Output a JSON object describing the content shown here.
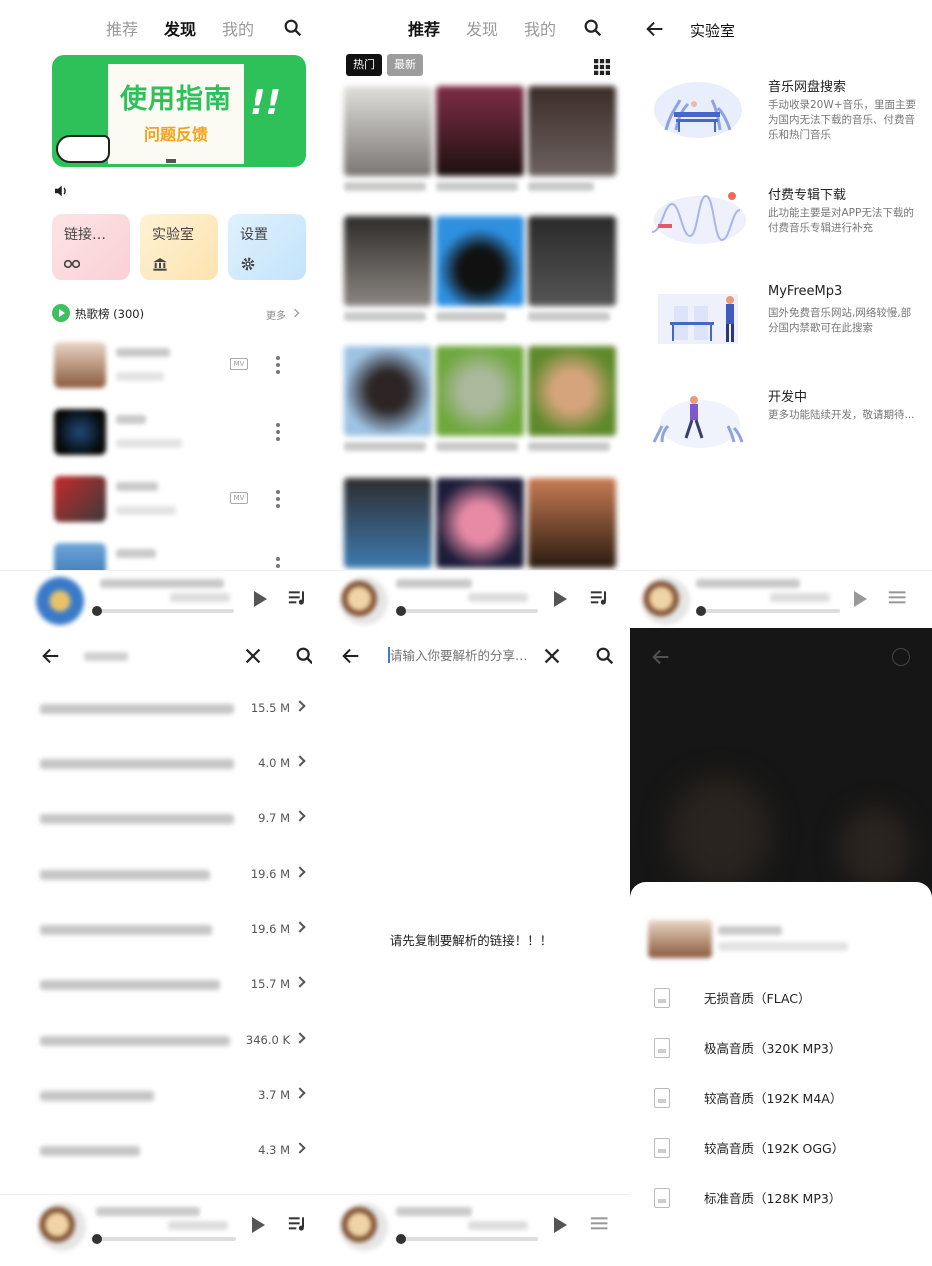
{
  "discover": {
    "tabs": [
      "推荐",
      "发现",
      "我的"
    ],
    "banner": {
      "title": "使用指南",
      "subtitle": "问题反馈"
    },
    "quick": [
      "链接…",
      "实验室",
      "设置"
    ],
    "chart": {
      "title": "热歌榜 (300)",
      "more": "更多"
    },
    "mv_badge": "MV"
  },
  "recommend": {
    "tabs": [
      "推荐",
      "发现",
      "我的"
    ],
    "filters": [
      "热门",
      "最新"
    ]
  },
  "lab": {
    "title": "实验室",
    "items": [
      {
        "title": "音乐网盘搜索",
        "desc": "手动收录20W+音乐，里面主要为国内无法下载的音乐、付费音乐和热门音乐"
      },
      {
        "title": "付费专辑下载",
        "desc": "此功能主要是对APP无法下载的付费音乐专辑进行补充"
      },
      {
        "title": "MyFreeMp3",
        "desc": "国外免费音乐网站,网络较慢,部分国内禁歌可在此搜索"
      },
      {
        "title": "开发中",
        "desc": "更多功能陆续开发，敬请期待..."
      }
    ]
  },
  "results": {
    "sizes": [
      "15.5 M",
      "4.0 M",
      "9.7 M",
      "19.6 M",
      "19.6 M",
      "15.7 M",
      "346.0 K",
      "3.7 M",
      "4.3 M"
    ]
  },
  "parse": {
    "placeholder": "请输入你要解析的分享…",
    "empty_text": "请先复制要解析的链接！！！"
  },
  "quality": {
    "options": [
      "无损音质（FLAC）",
      "极高音质（320K MP3）",
      "较高音质（192K M4A）",
      "较高音质（192K OGG）",
      "标准音质（128K MP3）"
    ]
  },
  "colors": {
    "accent": "#3fbf5f",
    "banner_green": "#2ec15a"
  }
}
